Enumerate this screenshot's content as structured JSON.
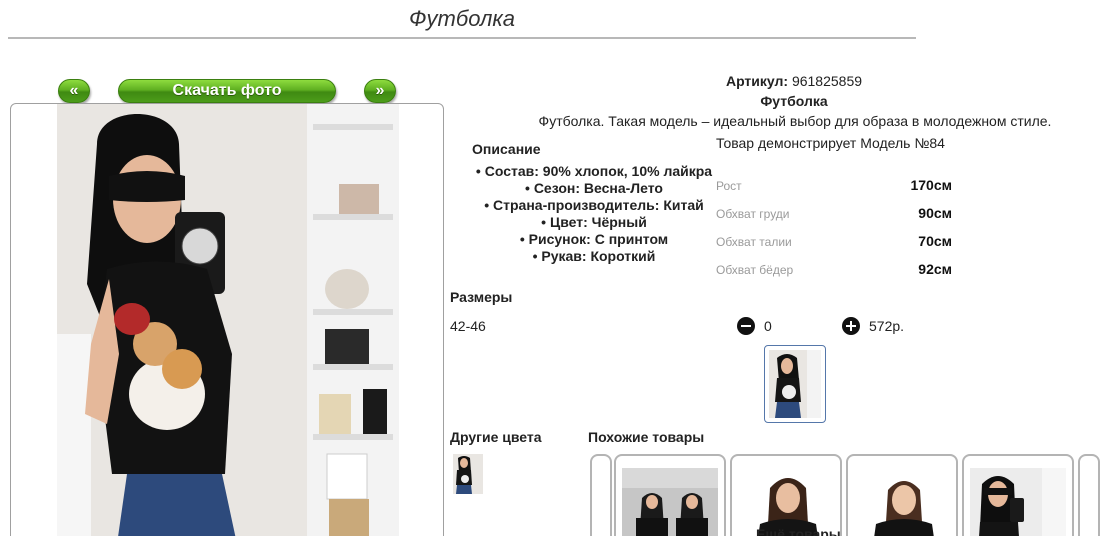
{
  "page": {
    "title": "Футболка"
  },
  "gallery": {
    "prev_label": "«",
    "download_label": "Скачать фото",
    "next_label": "»"
  },
  "product": {
    "article_label": "Артикул:",
    "article_value": "961825859",
    "name": "Футболка",
    "description": "Футболка. Такая модель – идеальный выбор для образа в молодежном стиле.",
    "model_line": "Товар демонстрирует Модель №84"
  },
  "specs": {
    "heading": "Описание",
    "items": [
      "• Состав: 90% хлопок, 10% лайкра",
      "• Сезон: Весна-Лето",
      "• Страна-производитель: Китай",
      "• Цвет: Чёрный",
      "• Рисунок: С принтом",
      "• Рукав: Короткий"
    ]
  },
  "measurements": [
    {
      "label": "Рост",
      "value": "170см"
    },
    {
      "label": "Обхват груди",
      "value": "90см"
    },
    {
      "label": "Обхват талии",
      "value": "70см"
    },
    {
      "label": "Обхват бёдер",
      "value": "92см"
    }
  ],
  "sizes": {
    "heading": "Размеры",
    "size": "42-46",
    "quantity": "0",
    "price": "572р.",
    "minus_icon": "minus-circle-icon",
    "plus_icon": "plus-circle-icon"
  },
  "other_colors": {
    "heading": "Другие цвета"
  },
  "similar": {
    "heading": "Похожие товары",
    "more_label": "Ещё товары"
  },
  "colors": {
    "button_green": "#5fb021",
    "frame_border": "#a0a0a0",
    "thumb_border": "#5577aa"
  }
}
